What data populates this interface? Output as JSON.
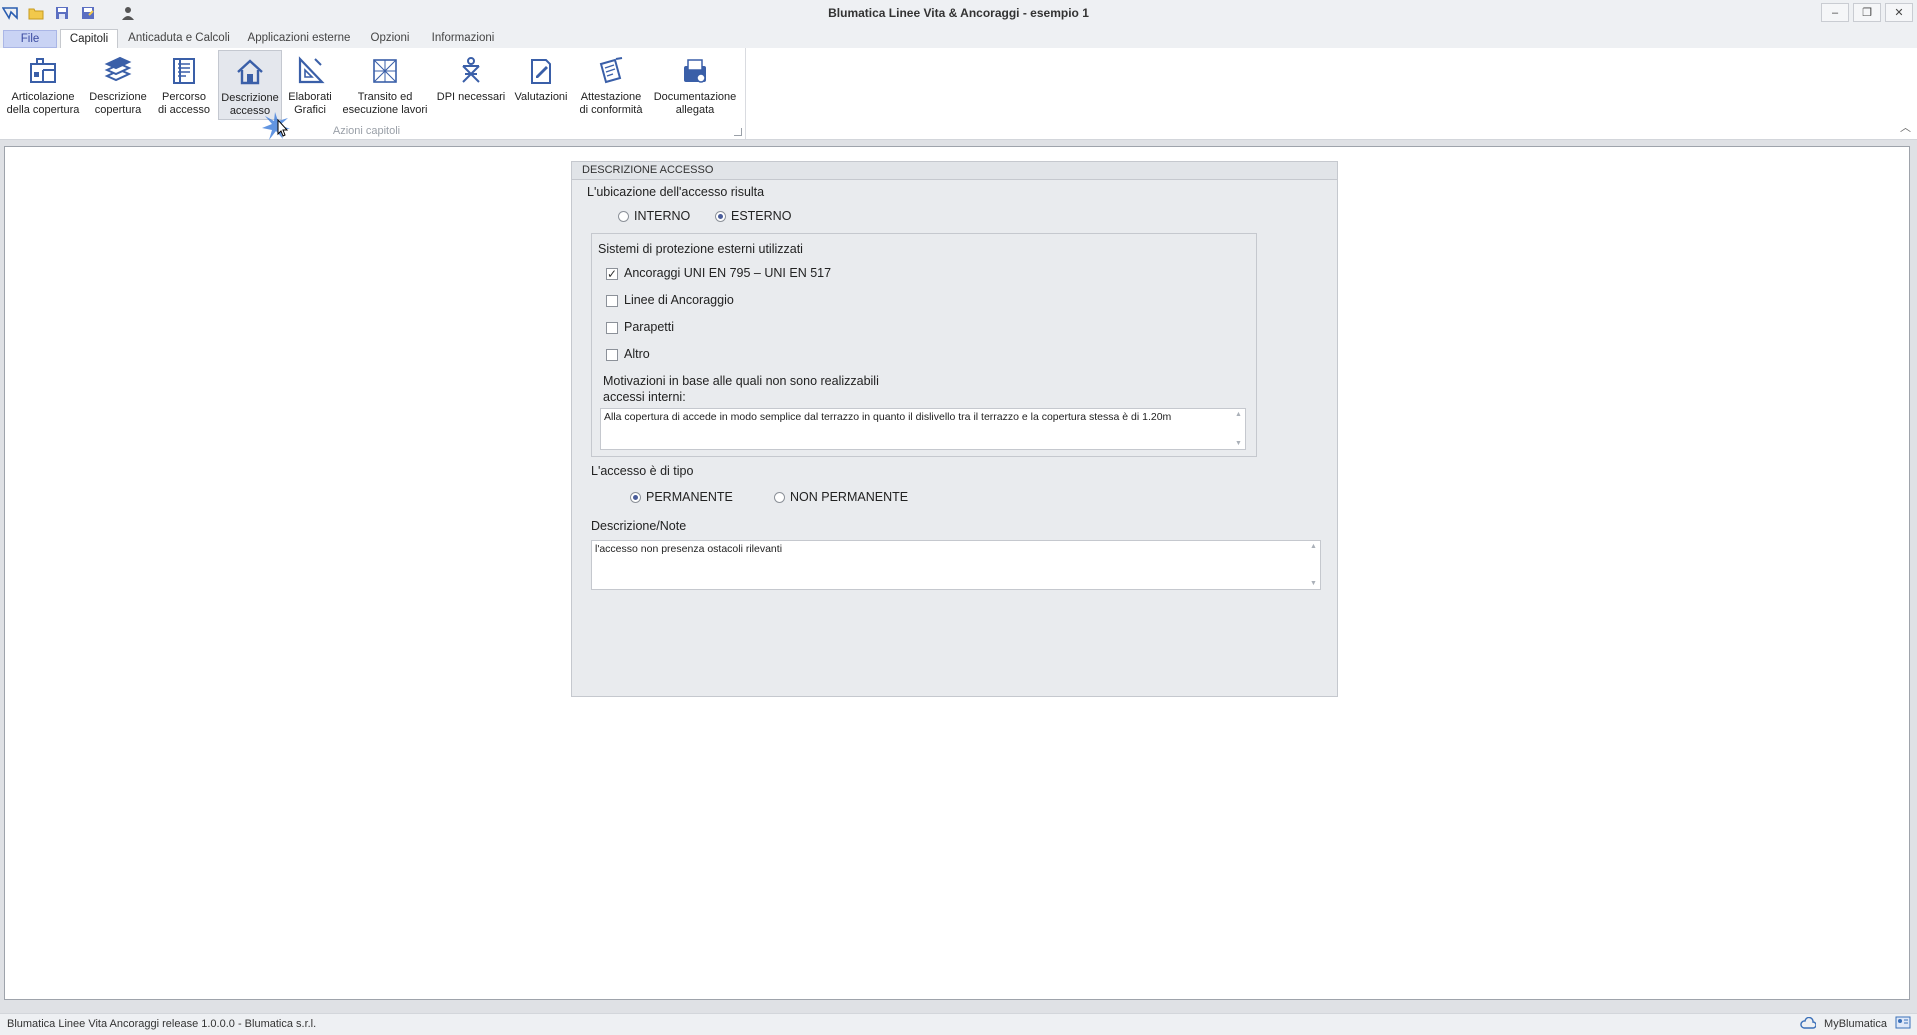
{
  "window": {
    "title": "Blumatica Linee Vita & Ancoraggi - esempio 1"
  },
  "quick_access": [
    "app-icon",
    "open-folder-icon",
    "save-icon",
    "save-as-icon",
    "user-icon"
  ],
  "window_buttons": {
    "minimize": "–",
    "restore": "❐",
    "close": "✕"
  },
  "tabs": [
    {
      "label": "File"
    },
    {
      "label": "Capitoli"
    },
    {
      "label": "Anticaduta e Calcoli"
    },
    {
      "label": "Applicazioni esterne"
    },
    {
      "label": "Opzioni"
    },
    {
      "label": "Informazioni"
    }
  ],
  "ribbon": {
    "group_label": "Azioni capitoli",
    "buttons": [
      {
        "line1": "Articolazione",
        "line2": "della copertura",
        "icon": "structure-icon"
      },
      {
        "line1": "Descrizione",
        "line2": "copertura",
        "icon": "book-stack-icon"
      },
      {
        "line1": "Percorso",
        "line2": "di accesso",
        "icon": "path-document-icon"
      },
      {
        "line1": "Descrizione",
        "line2": "accesso",
        "icon": "house-icon"
      },
      {
        "line1": "Elaborati",
        "line2": "Grafici",
        "icon": "drafting-triangle-icon"
      },
      {
        "line1": "Transito ed",
        "line2": "esecuzione lavori",
        "icon": "walkway-icon"
      },
      {
        "line1": "DPI necessari",
        "line2": "",
        "icon": "harness-icon"
      },
      {
        "line1": "Valutazioni",
        "line2": "",
        "icon": "evaluation-icon"
      },
      {
        "line1": "Attestazione",
        "line2": "di conformità",
        "icon": "signed-document-icon"
      },
      {
        "line1": "Documentazione",
        "line2": "allegata",
        "icon": "attachment-box-icon"
      }
    ]
  },
  "panel": {
    "header": "DESCRIZIONE ACCESSO",
    "location_label": "L'ubicazione dell'accesso risulta",
    "location_options": [
      {
        "label": "INTERNO",
        "selected": false
      },
      {
        "label": "ESTERNO",
        "selected": true
      }
    ],
    "systems_title": "Sistemi di protezione esterni utilizzati",
    "systems": [
      {
        "label": "Ancoraggi UNI EN 795 – UNI EN 517",
        "checked": true
      },
      {
        "label": "Linee di Ancoraggio",
        "checked": false
      },
      {
        "label": "Parapetti",
        "checked": false
      },
      {
        "label": "Altro",
        "checked": false
      }
    ],
    "motivation_label_1": "Motivazioni in base alle quali non sono realizzabili",
    "motivation_label_2": "accessi interni:",
    "motivation_text": "Alla copertura di accede in modo semplice dal terrazzo in quanto il dislivello tra il terrazzo e la copertura stessa è di 1.20m",
    "type_label": "L'accesso è di tipo",
    "type_options": [
      {
        "label": "PERMANENTE",
        "selected": true
      },
      {
        "label": "NON PERMANENTE",
        "selected": false
      }
    ],
    "notes_label": "Descrizione/Note",
    "notes_text": "l'accesso non presenza ostacoli rilevanti"
  },
  "statusbar": {
    "left": "Blumatica Linee Vita  Ancoraggi release 1.0.0.0 - Blumatica s.r.l.",
    "right": "MyBlumatica"
  }
}
